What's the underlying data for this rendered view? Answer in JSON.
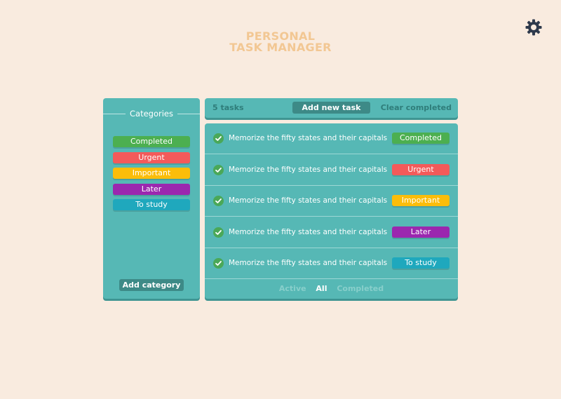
{
  "title": {
    "line1": "PERSONAL",
    "line2": "TASK MANAGER"
  },
  "settings_icon": "gear-icon",
  "colors": {
    "background": "#f9ebdf",
    "panel": "#56b8b5",
    "title": "#f2c793",
    "completed": "#4caf50",
    "urgent": "#f35a5a",
    "important": "#fbbd0a",
    "later": "#9b27af",
    "to_study": "#1fa8bd"
  },
  "sidebar": {
    "header": "Categories",
    "categories": [
      {
        "label": "Completed",
        "color": "#4caf50"
      },
      {
        "label": "Urgent",
        "color": "#f35a5a"
      },
      {
        "label": "Important",
        "color": "#fbbd0a"
      },
      {
        "label": "Later",
        "color": "#9b27af"
      },
      {
        "label": "To study",
        "color": "#1fa8bd"
      }
    ],
    "add_category_label": "Add category"
  },
  "toolbar": {
    "task_count": "5 tasks",
    "add_task_label": "Add new task",
    "clear_completed_label": "Clear completed"
  },
  "tasks": [
    {
      "text": "Memorize the fifty states and their capitals",
      "tag": "Completed",
      "tag_color": "#4caf50",
      "done": true
    },
    {
      "text": "Memorize the fifty states and their capitals",
      "tag": "Urgent",
      "tag_color": "#f35a5a",
      "done": true
    },
    {
      "text": "Memorize the fifty states and their capitals",
      "tag": "Important",
      "tag_color": "#fbbd0a",
      "done": true
    },
    {
      "text": "Memorize the fifty states and their capitals",
      "tag": "Later",
      "tag_color": "#9b27af",
      "done": true
    },
    {
      "text": "Memorize the fifty states and their capitals",
      "tag": "To study",
      "tag_color": "#1fa8bd",
      "done": true
    }
  ],
  "filters": {
    "active": "Active",
    "all": "All",
    "completed": "Completed",
    "selected": "all"
  }
}
